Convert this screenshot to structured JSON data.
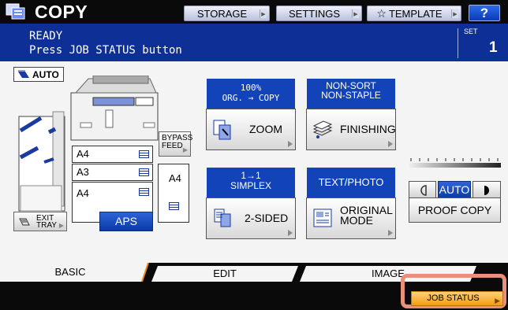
{
  "titlebar": {
    "title": "COPY",
    "buttons": {
      "storage": "STORAGE",
      "settings": "SETTINGS",
      "template": "TEMPLATE"
    },
    "help": "?"
  },
  "message": {
    "line1": "READY",
    "line2": "Press JOB STATUS button",
    "set_label": "SET",
    "set_value": "1"
  },
  "original_mode_indicator": "AUTO",
  "paper": {
    "drawers": [
      {
        "size": "A4"
      },
      {
        "size": "A3"
      },
      {
        "size": "A4"
      }
    ],
    "bypass_label_line1": "BYPASS",
    "bypass_label_line2": "FEED",
    "bypass_size": "A4"
  },
  "exit_tray": {
    "line1": "EXIT",
    "line2": "TRAY"
  },
  "aps": "APS",
  "zoom": {
    "info_line1": "100%",
    "info_line2": "ORG. → COPY",
    "label": "ZOOM"
  },
  "finishing": {
    "info_line1": "NON-SORT",
    "info_line2": "NON-STAPLE",
    "label": "FINISHING"
  },
  "sided": {
    "info_line1": "1→1",
    "info_line2": "SIMPLEX",
    "label": "2-SIDED"
  },
  "original_mode": {
    "info": "TEXT/PHOTO",
    "label_line1": "ORIGINAL",
    "label_line2": "MODE"
  },
  "density": {
    "auto": "AUTO",
    "level_fraction": 0.5
  },
  "proof_copy": "PROOF COPY",
  "tabs": {
    "basic": "BASIC",
    "edit": "EDIT",
    "image": "IMAGE"
  },
  "status": {
    "job_status": "JOB STATUS"
  },
  "colors": {
    "header_blue": "#0e2f95",
    "button_blue": "#1243b8",
    "job_status_orange": "#f39c12",
    "highlight": "#e8907a"
  }
}
